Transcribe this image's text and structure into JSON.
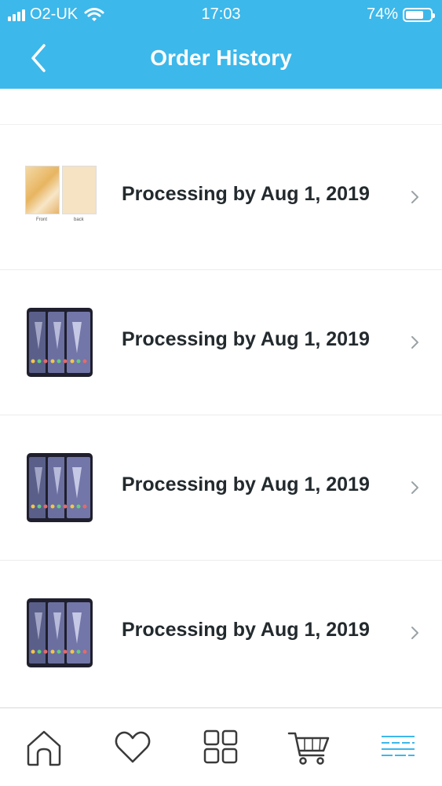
{
  "status_bar": {
    "carrier": "O2-UK",
    "time": "17:03",
    "battery_percent": "74%",
    "battery_level": 0.74
  },
  "nav": {
    "title": "Order History",
    "back_icon": "chevron-left-icon"
  },
  "orders": [
    {
      "status": "Processing by Aug 1, 2019",
      "thumbnail": "tablet-case",
      "thumb_labels": [
        "Front",
        "back"
      ]
    },
    {
      "status": "Processing by Aug 1, 2019",
      "thumbnail": "phones"
    },
    {
      "status": "Processing by Aug 1, 2019",
      "thumbnail": "phones"
    },
    {
      "status": "Processing by Aug 1, 2019",
      "thumbnail": "phones"
    }
  ],
  "tab_bar": {
    "tabs": [
      {
        "icon": "home-icon"
      },
      {
        "icon": "heart-icon"
      },
      {
        "icon": "grid-icon"
      },
      {
        "icon": "cart-icon"
      },
      {
        "icon": "menu-icon",
        "active": true
      }
    ]
  },
  "colors": {
    "header": "#3db8ea",
    "active_tab": "#3db8ea",
    "inactive_tab": "#3a3a3a"
  }
}
